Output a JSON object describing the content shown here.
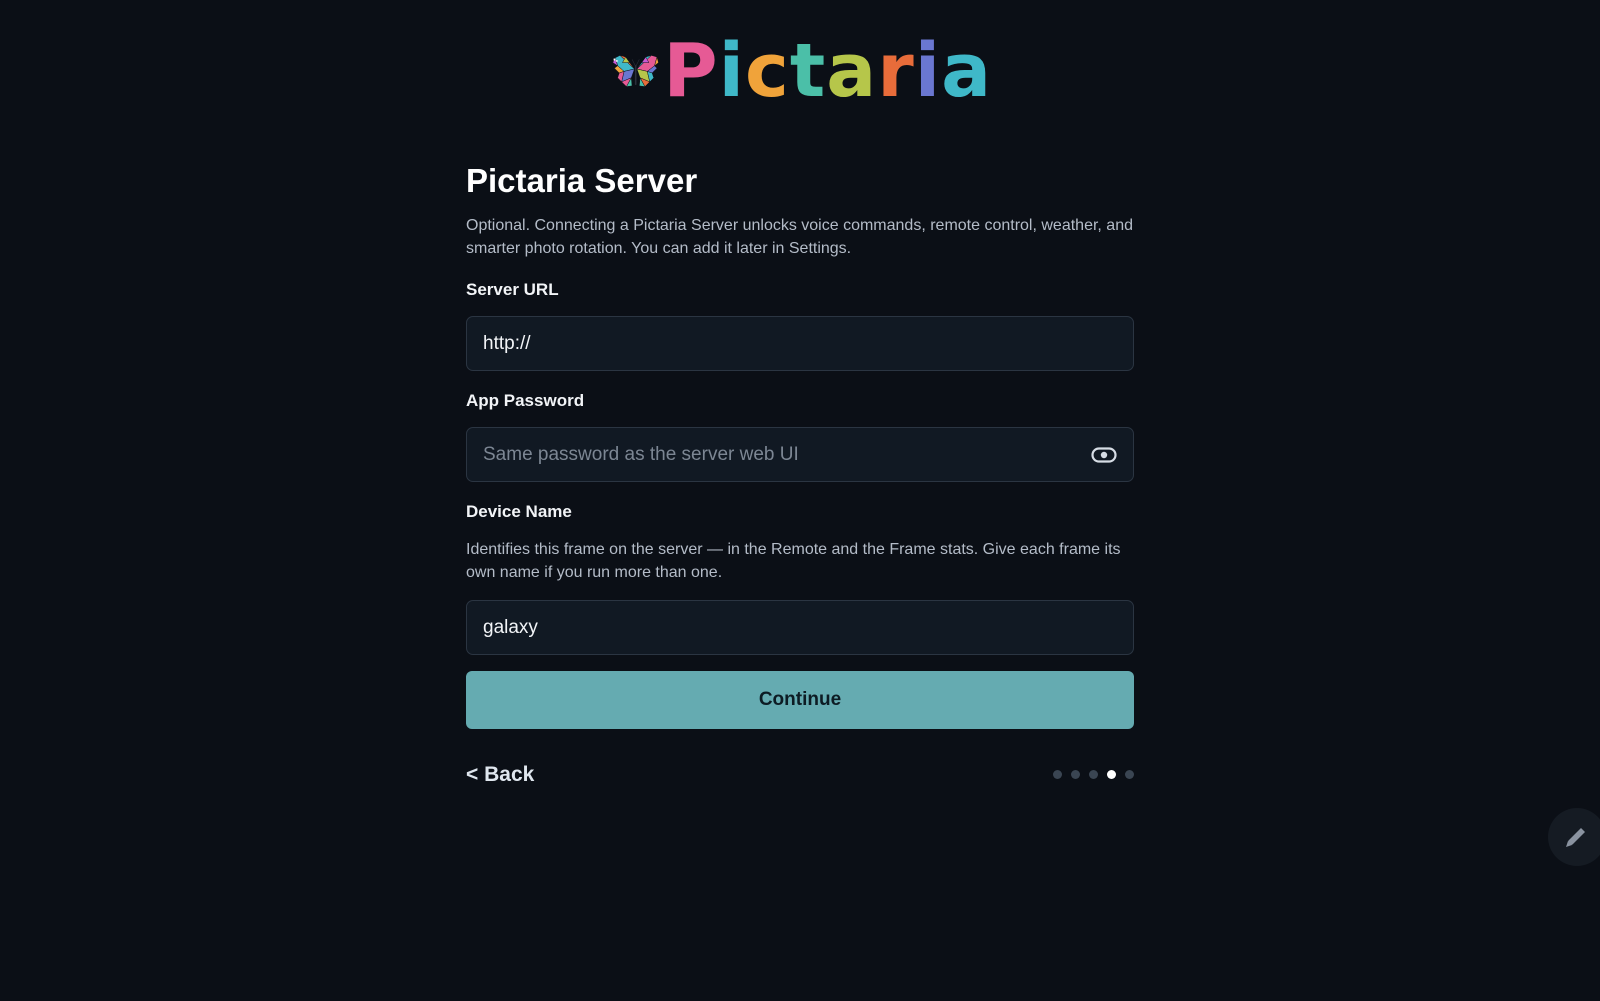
{
  "logo": {
    "wordmark": "Pictaria",
    "colors": [
      "#e65a95",
      "#3fb8c8",
      "#f0a33a",
      "#b6c64a",
      "#6a77d1",
      "#c85ad4",
      "#4bbfa8",
      "#e86c3a"
    ]
  },
  "page": {
    "title": "Pictaria Server",
    "description": "Optional. Connecting a Pictaria Server unlocks voice commands, remote control, weather, and smarter photo rotation. You can add it later in Settings."
  },
  "fields": {
    "server_url": {
      "label": "Server URL",
      "value": "http://"
    },
    "app_password": {
      "label": "App Password",
      "value": "",
      "placeholder": "Same password as the server web UI",
      "toggle_icon": "eye-icon"
    },
    "device_name": {
      "label": "Device Name",
      "description": "Identifies this frame on the server — in the Remote and the Frame stats. Give each frame its own name if you run more than one.",
      "value": "galaxy"
    }
  },
  "actions": {
    "continue_label": "Continue",
    "back_label": "< Back",
    "edit_icon": "pencil-icon"
  },
  "progress": {
    "total_steps": 5,
    "current_step": 4
  },
  "colors": {
    "background": "#0b0f16",
    "accent": "#65abb1",
    "input_bg": "#111923",
    "input_border": "#2b3542"
  }
}
